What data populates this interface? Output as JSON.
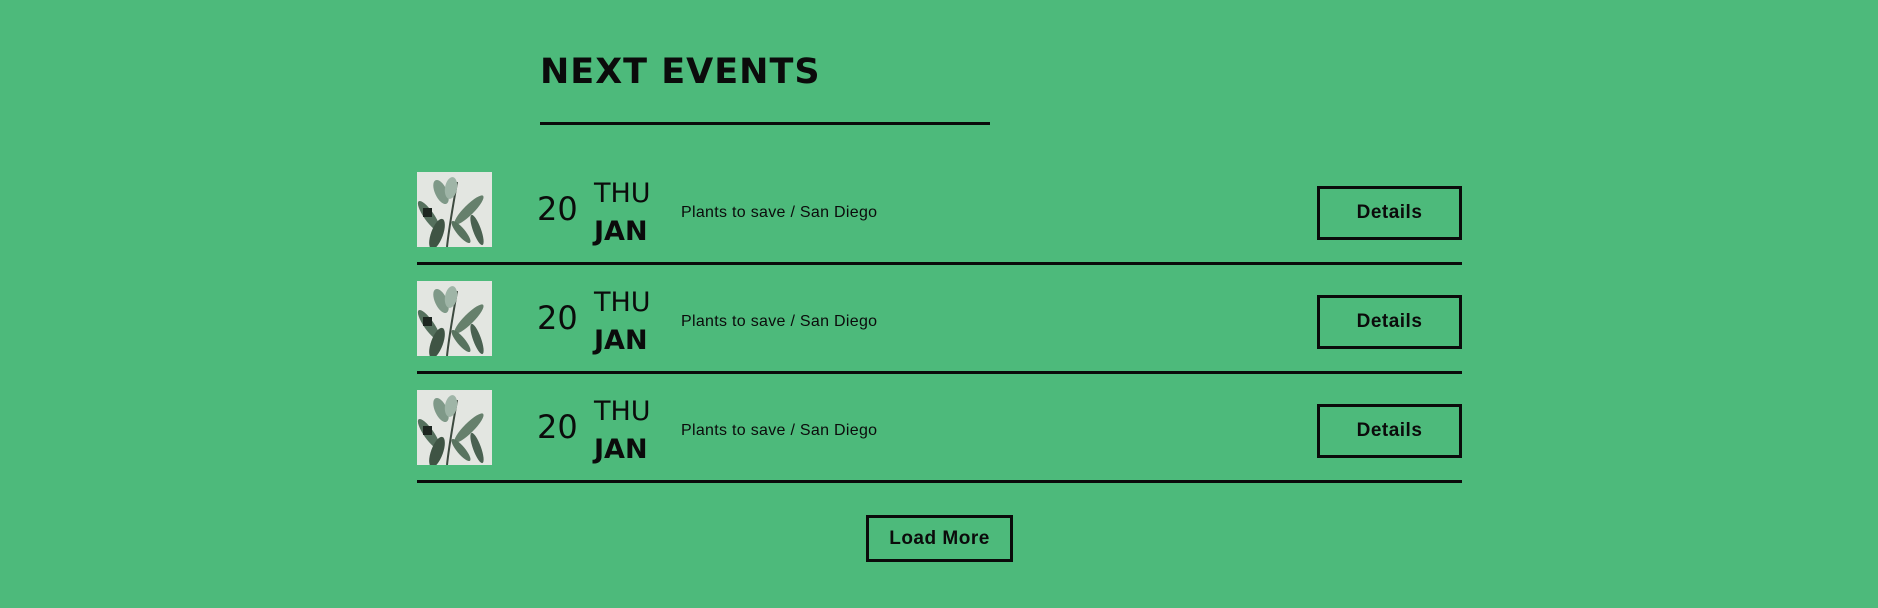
{
  "section": {
    "title": "NEXT EVENTS"
  },
  "events": [
    {
      "image": "plant-photo",
      "day": "20",
      "weekday": "THU",
      "month": "JAN",
      "description": "Plants to save / San Diego",
      "button_label": "Details"
    },
    {
      "image": "plant-photo",
      "day": "20",
      "weekday": "THU",
      "month": "JAN",
      "description": "Plants to save / San Diego",
      "button_label": "Details"
    },
    {
      "image": "plant-photo",
      "day": "20",
      "weekday": "THU",
      "month": "JAN",
      "description": "Plants to save / San Diego",
      "button_label": "Details"
    }
  ],
  "load_more_label": "Load More",
  "colors": {
    "background": "#4dba7b",
    "text": "#0b0b0b",
    "thumb_background": "#e3e6e1"
  }
}
